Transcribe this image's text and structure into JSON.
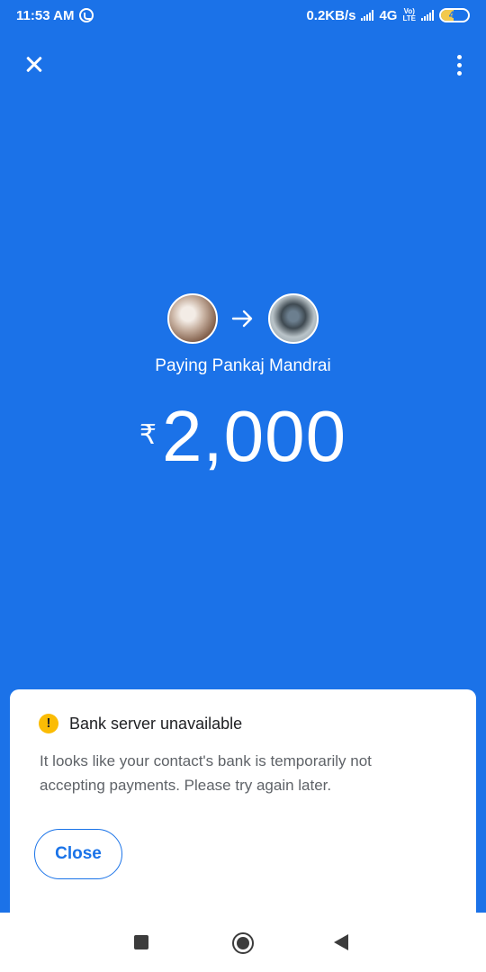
{
  "status_bar": {
    "time": "11:53 AM",
    "net_speed": "0.2KB/s",
    "network_type": "4G",
    "volte_top": "Vo)",
    "volte_bottom": "LTE",
    "battery": "45",
    "battery_level": 0.45,
    "icons": [
      "whatsapp-icon",
      "signal-icon",
      "volte-icon",
      "signal-icon",
      "battery-icon"
    ]
  },
  "app_bar": {
    "close_icon": "close-icon",
    "more_icon": "more-vert-icon"
  },
  "payment": {
    "paying_label": "Paying Pankaj Mandrai",
    "currency_symbol": "₹",
    "amount": "2,000",
    "arrow_icon": "arrow-right-icon"
  },
  "error_sheet": {
    "title": "Bank server unavailable",
    "message": "It looks like your contact's bank is temporarily not accepting payments. Please try again later.",
    "close_label": "Close",
    "warning_symbol": "!",
    "accent_color": "#1a73e8",
    "warning_color": "#fbbc04"
  },
  "colors": {
    "background": "#1b72e8"
  },
  "nav": {
    "icons": [
      "recents-icon",
      "home-icon",
      "back-icon"
    ]
  }
}
